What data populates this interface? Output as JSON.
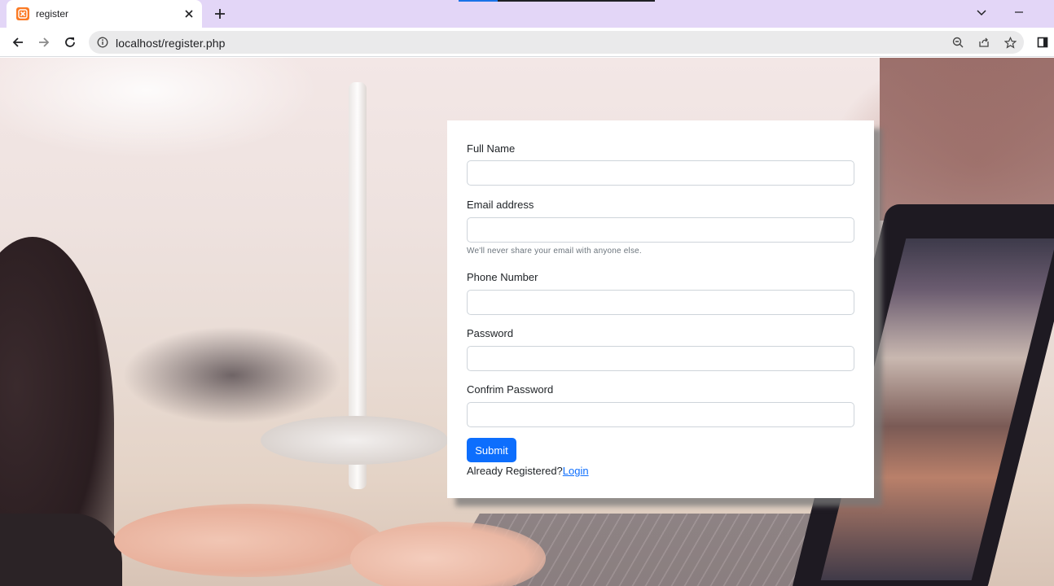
{
  "browser": {
    "tab_title": "register",
    "url": "localhost/register.php",
    "icons": {
      "favicon": "xampp-icon",
      "tab_close": "close-icon",
      "new_tab": "plus-icon",
      "tab_search": "chevron-down-icon",
      "minimize": "minimize-icon",
      "back": "arrow-left-icon",
      "forward": "arrow-right-icon",
      "reload": "reload-icon",
      "site_info": "info-icon",
      "zoom": "zoom-out-icon",
      "share": "share-icon",
      "bookmark": "star-icon",
      "side_panel": "side-panel-icon"
    },
    "colors": {
      "tabbar": "#e3d6f7",
      "omnibox": "#eaeaeb"
    }
  },
  "form": {
    "full_name_label": "Full Name",
    "email_label": "Email address",
    "email_help": "We'll never share your email with anyone else.",
    "phone_label": "Phone Number",
    "password_label": "Password",
    "confirm_password_label": "Confrim Password",
    "full_name_value": "",
    "email_value": "",
    "phone_value": "",
    "password_value": "",
    "confirm_password_value": "",
    "submit_label": "Submit",
    "already_registered_text": "Already Registered?",
    "login_link_text": "Login",
    "colors": {
      "primary": "#0d6efd",
      "help_text": "#6c757d"
    }
  }
}
